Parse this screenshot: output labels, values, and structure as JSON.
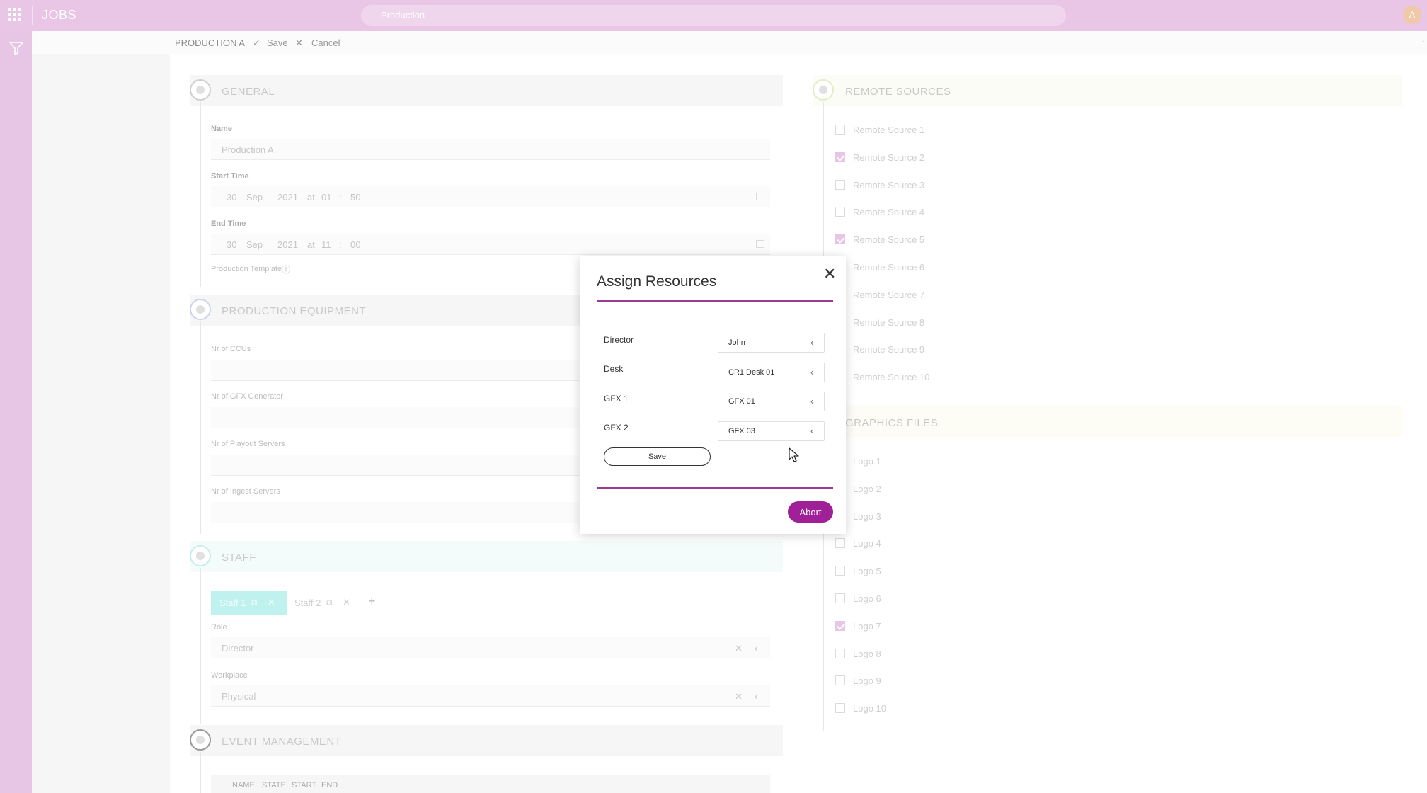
{
  "topbar": {
    "app_title": "JOBS",
    "search_value": "Production",
    "avatar_initial": "A"
  },
  "subbar": {
    "crumb": "PRODUCTION A",
    "save_label": "Save",
    "cancel_label": "Cancel",
    "more": "···"
  },
  "general": {
    "title": "GENERAL",
    "name_label": "Name",
    "name_value": "Production A",
    "start_label": "Start Time",
    "start": {
      "day": "30",
      "month": "Sep",
      "year": "2021",
      "at": "at",
      "hour": "01",
      "sep": ":",
      "minute": "50"
    },
    "end_label": "End Time",
    "end": {
      "day": "30",
      "month": "Sep",
      "year": "2021",
      "at": "at",
      "hour": "11",
      "sep": ":",
      "minute": "00"
    },
    "template_label": "Production Template"
  },
  "equipment": {
    "title": "PRODUCTION EQUIPMENT",
    "fields": [
      "Nr of CCUs",
      "Nr of GFX Generator",
      "Nr of Playout Servers",
      "Nr of Ingest Servers"
    ]
  },
  "staff": {
    "title": "STAFF",
    "tabs": [
      "Staff 1",
      "Staff 2"
    ],
    "role_label": "Role",
    "role_value": "Director",
    "workplace_label": "Workplace",
    "workplace_value": "Physical"
  },
  "event": {
    "title": "EVENT MANAGEMENT",
    "columns": [
      "NAME",
      "STATE",
      "START",
      "END"
    ]
  },
  "remote_sources": {
    "title": "REMOTE SOURCES",
    "items": [
      {
        "label": "Remote Source 1",
        "checked": false
      },
      {
        "label": "Remote Source 2",
        "checked": true
      },
      {
        "label": "Remote Source 3",
        "checked": false
      },
      {
        "label": "Remote Source 4",
        "checked": false
      },
      {
        "label": "Remote Source 5",
        "checked": true
      },
      {
        "label": "Remote Source 6",
        "checked": false
      },
      {
        "label": "Remote Source 7",
        "checked": false
      },
      {
        "label": "Remote Source 8",
        "checked": false
      },
      {
        "label": "Remote Source 9",
        "checked": false
      },
      {
        "label": "Remote Source 10",
        "checked": false
      }
    ]
  },
  "graphics_files": {
    "title": "GRAPHICS FILES",
    "items": [
      {
        "label": "Logo 1",
        "checked": false
      },
      {
        "label": "Logo 2",
        "checked": false
      },
      {
        "label": "Logo 3",
        "checked": false
      },
      {
        "label": "Logo 4",
        "checked": false
      },
      {
        "label": "Logo 5",
        "checked": false
      },
      {
        "label": "Logo 6",
        "checked": false
      },
      {
        "label": "Logo 7",
        "checked": true
      },
      {
        "label": "Logo 8",
        "checked": false
      },
      {
        "label": "Logo 9",
        "checked": false
      },
      {
        "label": "Logo 10",
        "checked": false
      }
    ]
  },
  "modal": {
    "title": "Assign Resources",
    "rows": [
      {
        "label": "Director",
        "value": "John"
      },
      {
        "label": "Desk",
        "value": "CR1 Desk 01"
      },
      {
        "label": "GFX 1",
        "value": "GFX 01"
      },
      {
        "label": "GFX 2",
        "value": "GFX 03"
      }
    ],
    "save_label": "Save",
    "abort_label": "Abort"
  },
  "colors": {
    "accent": "#a02197",
    "topbar": "#e9c6e6",
    "staff_tab": "#bff2ef"
  }
}
